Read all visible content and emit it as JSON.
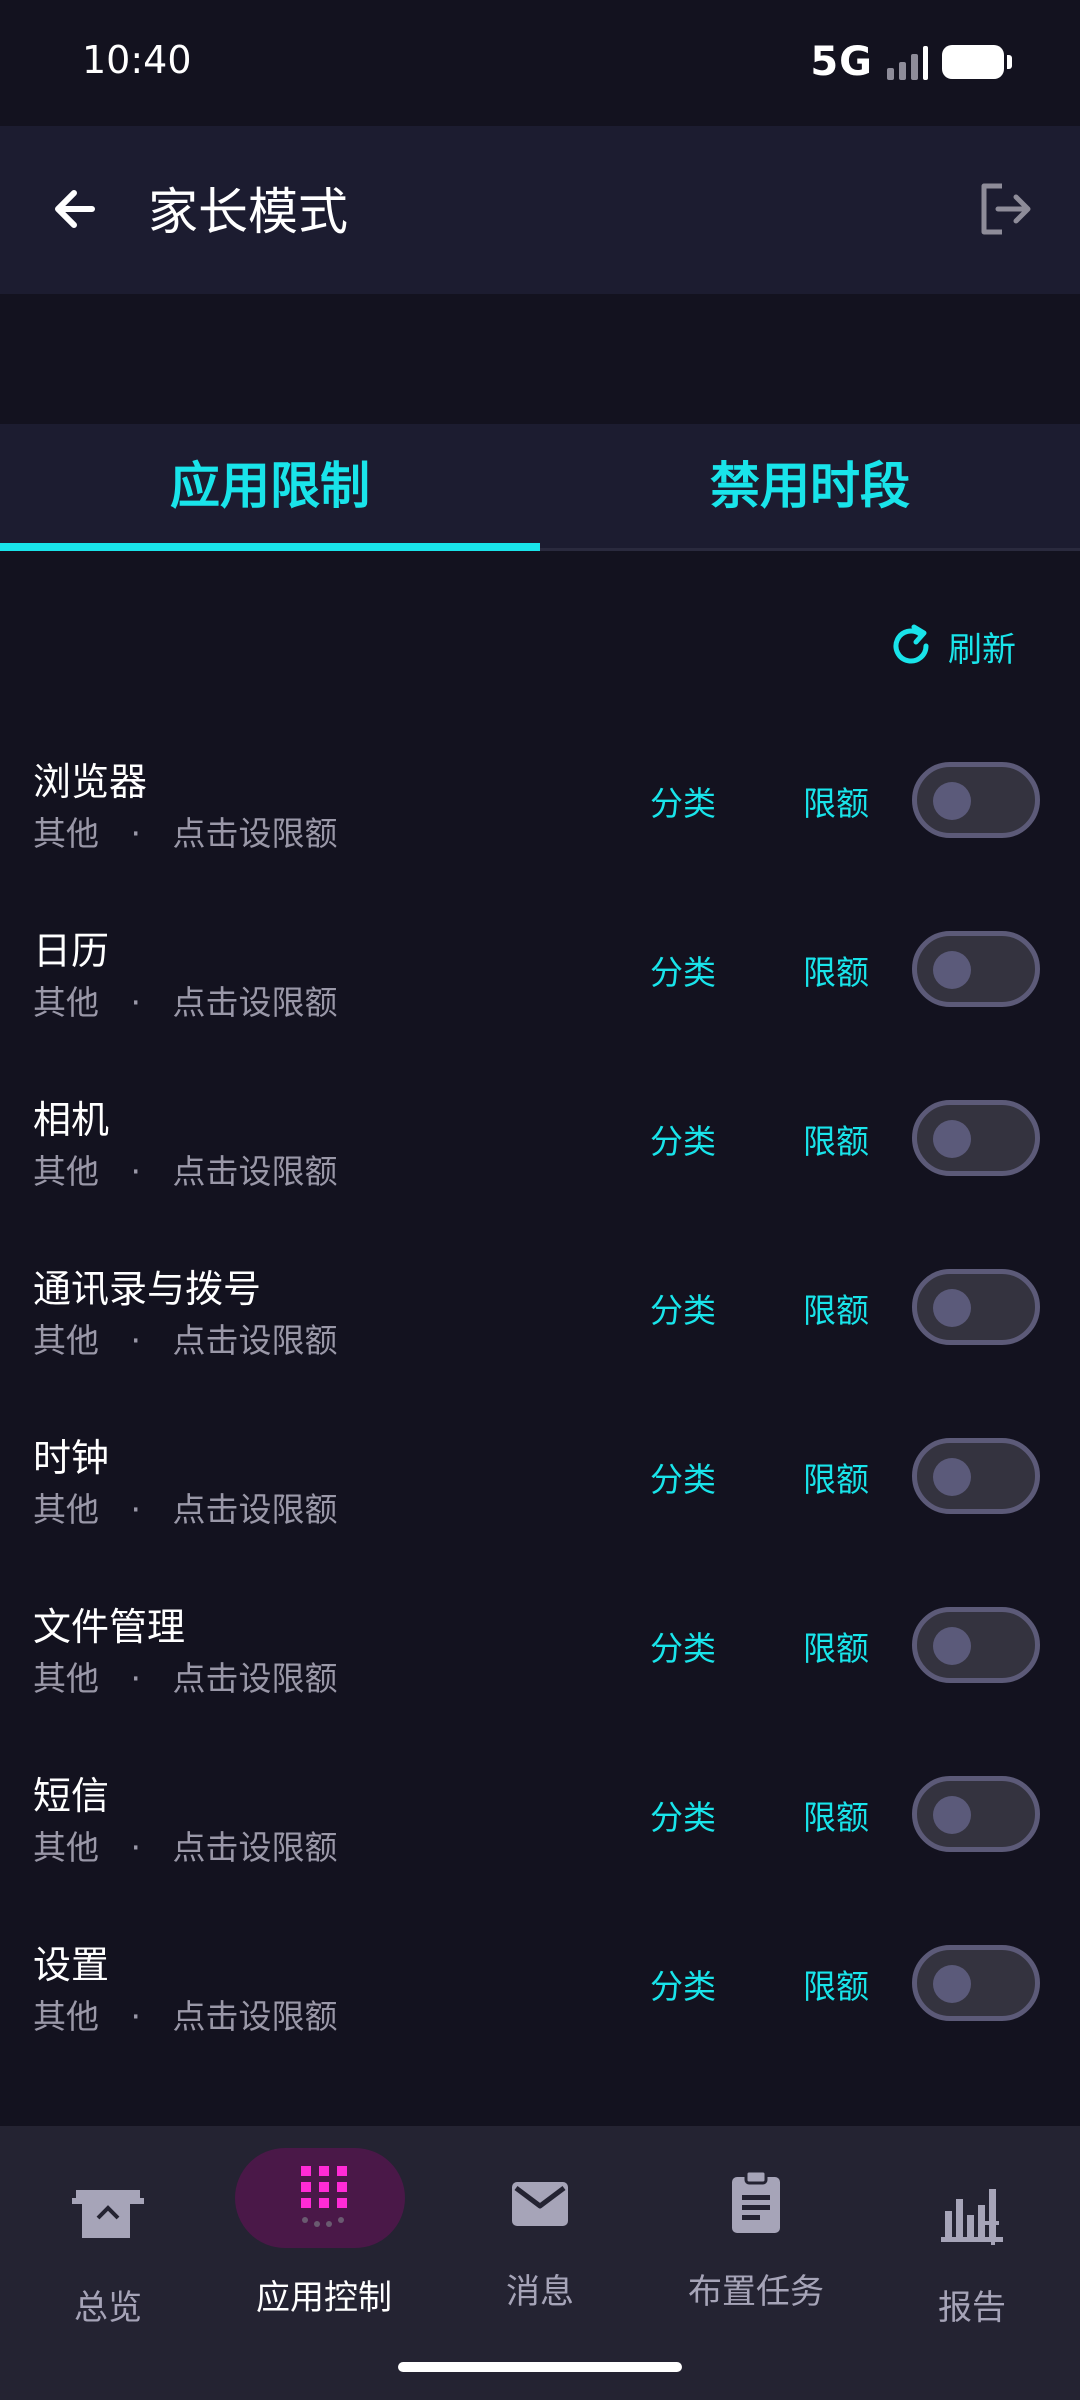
{
  "status": {
    "time": "10:40",
    "network": "5G"
  },
  "header": {
    "title": "家长模式"
  },
  "tabs": [
    {
      "label": "应用限制",
      "active": true
    },
    {
      "label": "禁用时段",
      "active": false
    }
  ],
  "refresh": {
    "label": "刷新"
  },
  "apps": [
    {
      "name": "浏览器",
      "category": "其他",
      "separator": "·",
      "hint": "点击设限额",
      "category_label": "分类",
      "quota_label": "限额",
      "enabled": false
    },
    {
      "name": "日历",
      "category": "其他",
      "separator": "·",
      "hint": "点击设限额",
      "category_label": "分类",
      "quota_label": "限额",
      "enabled": false
    },
    {
      "name": "相机",
      "category": "其他",
      "separator": "·",
      "hint": "点击设限额",
      "category_label": "分类",
      "quota_label": "限额",
      "enabled": false
    },
    {
      "name": "通讯录与拨号",
      "category": "其他",
      "separator": "·",
      "hint": "点击设限额",
      "category_label": "分类",
      "quota_label": "限额",
      "enabled": false
    },
    {
      "name": "时钟",
      "category": "其他",
      "separator": "·",
      "hint": "点击设限额",
      "category_label": "分类",
      "quota_label": "限额",
      "enabled": false
    },
    {
      "name": "文件管理",
      "category": "其他",
      "separator": "·",
      "hint": "点击设限额",
      "category_label": "分类",
      "quota_label": "限额",
      "enabled": false
    },
    {
      "name": "短信",
      "category": "其他",
      "separator": "·",
      "hint": "点击设限额",
      "category_label": "分类",
      "quota_label": "限额",
      "enabled": false
    },
    {
      "name": "设置",
      "category": "其他",
      "separator": "·",
      "hint": "点击设限额",
      "category_label": "分类",
      "quota_label": "限额",
      "enabled": false
    }
  ],
  "nav": [
    {
      "label": "总览",
      "icon": "overview-icon",
      "active": false
    },
    {
      "label": "应用控制",
      "icon": "app-grid-icon",
      "active": true
    },
    {
      "label": "消息",
      "icon": "mail-icon",
      "active": false
    },
    {
      "label": "布置任务",
      "icon": "clipboard-icon",
      "active": false
    },
    {
      "label": "报告",
      "icon": "bar-chart-icon",
      "active": false
    }
  ],
  "colors": {
    "accent": "#19e4ea",
    "active_nav": "#ff2bd6",
    "background": "#13121f",
    "surface": "#1c1c30"
  }
}
